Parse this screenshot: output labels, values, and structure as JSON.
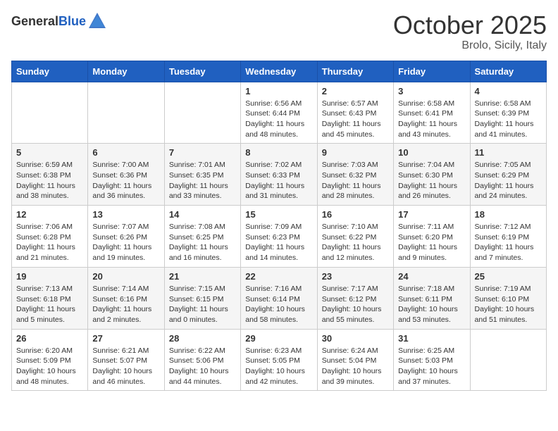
{
  "header": {
    "logo_general": "General",
    "logo_blue": "Blue",
    "month_title": "October 2025",
    "location": "Brolo, Sicily, Italy"
  },
  "days_of_week": [
    "Sunday",
    "Monday",
    "Tuesday",
    "Wednesday",
    "Thursday",
    "Friday",
    "Saturday"
  ],
  "weeks": [
    {
      "days": [
        {
          "number": "",
          "info": ""
        },
        {
          "number": "",
          "info": ""
        },
        {
          "number": "",
          "info": ""
        },
        {
          "number": "1",
          "info": "Sunrise: 6:56 AM\nSunset: 6:44 PM\nDaylight: 11 hours and 48 minutes."
        },
        {
          "number": "2",
          "info": "Sunrise: 6:57 AM\nSunset: 6:43 PM\nDaylight: 11 hours and 45 minutes."
        },
        {
          "number": "3",
          "info": "Sunrise: 6:58 AM\nSunset: 6:41 PM\nDaylight: 11 hours and 43 minutes."
        },
        {
          "number": "4",
          "info": "Sunrise: 6:58 AM\nSunset: 6:39 PM\nDaylight: 11 hours and 41 minutes."
        }
      ]
    },
    {
      "days": [
        {
          "number": "5",
          "info": "Sunrise: 6:59 AM\nSunset: 6:38 PM\nDaylight: 11 hours and 38 minutes."
        },
        {
          "number": "6",
          "info": "Sunrise: 7:00 AM\nSunset: 6:36 PM\nDaylight: 11 hours and 36 minutes."
        },
        {
          "number": "7",
          "info": "Sunrise: 7:01 AM\nSunset: 6:35 PM\nDaylight: 11 hours and 33 minutes."
        },
        {
          "number": "8",
          "info": "Sunrise: 7:02 AM\nSunset: 6:33 PM\nDaylight: 11 hours and 31 minutes."
        },
        {
          "number": "9",
          "info": "Sunrise: 7:03 AM\nSunset: 6:32 PM\nDaylight: 11 hours and 28 minutes."
        },
        {
          "number": "10",
          "info": "Sunrise: 7:04 AM\nSunset: 6:30 PM\nDaylight: 11 hours and 26 minutes."
        },
        {
          "number": "11",
          "info": "Sunrise: 7:05 AM\nSunset: 6:29 PM\nDaylight: 11 hours and 24 minutes."
        }
      ]
    },
    {
      "days": [
        {
          "number": "12",
          "info": "Sunrise: 7:06 AM\nSunset: 6:28 PM\nDaylight: 11 hours and 21 minutes."
        },
        {
          "number": "13",
          "info": "Sunrise: 7:07 AM\nSunset: 6:26 PM\nDaylight: 11 hours and 19 minutes."
        },
        {
          "number": "14",
          "info": "Sunrise: 7:08 AM\nSunset: 6:25 PM\nDaylight: 11 hours and 16 minutes."
        },
        {
          "number": "15",
          "info": "Sunrise: 7:09 AM\nSunset: 6:23 PM\nDaylight: 11 hours and 14 minutes."
        },
        {
          "number": "16",
          "info": "Sunrise: 7:10 AM\nSunset: 6:22 PM\nDaylight: 11 hours and 12 minutes."
        },
        {
          "number": "17",
          "info": "Sunrise: 7:11 AM\nSunset: 6:20 PM\nDaylight: 11 hours and 9 minutes."
        },
        {
          "number": "18",
          "info": "Sunrise: 7:12 AM\nSunset: 6:19 PM\nDaylight: 11 hours and 7 minutes."
        }
      ]
    },
    {
      "days": [
        {
          "number": "19",
          "info": "Sunrise: 7:13 AM\nSunset: 6:18 PM\nDaylight: 11 hours and 5 minutes."
        },
        {
          "number": "20",
          "info": "Sunrise: 7:14 AM\nSunset: 6:16 PM\nDaylight: 11 hours and 2 minutes."
        },
        {
          "number": "21",
          "info": "Sunrise: 7:15 AM\nSunset: 6:15 PM\nDaylight: 11 hours and 0 minutes."
        },
        {
          "number": "22",
          "info": "Sunrise: 7:16 AM\nSunset: 6:14 PM\nDaylight: 10 hours and 58 minutes."
        },
        {
          "number": "23",
          "info": "Sunrise: 7:17 AM\nSunset: 6:12 PM\nDaylight: 10 hours and 55 minutes."
        },
        {
          "number": "24",
          "info": "Sunrise: 7:18 AM\nSunset: 6:11 PM\nDaylight: 10 hours and 53 minutes."
        },
        {
          "number": "25",
          "info": "Sunrise: 7:19 AM\nSunset: 6:10 PM\nDaylight: 10 hours and 51 minutes."
        }
      ]
    },
    {
      "days": [
        {
          "number": "26",
          "info": "Sunrise: 6:20 AM\nSunset: 5:09 PM\nDaylight: 10 hours and 48 minutes."
        },
        {
          "number": "27",
          "info": "Sunrise: 6:21 AM\nSunset: 5:07 PM\nDaylight: 10 hours and 46 minutes."
        },
        {
          "number": "28",
          "info": "Sunrise: 6:22 AM\nSunset: 5:06 PM\nDaylight: 10 hours and 44 minutes."
        },
        {
          "number": "29",
          "info": "Sunrise: 6:23 AM\nSunset: 5:05 PM\nDaylight: 10 hours and 42 minutes."
        },
        {
          "number": "30",
          "info": "Sunrise: 6:24 AM\nSunset: 5:04 PM\nDaylight: 10 hours and 39 minutes."
        },
        {
          "number": "31",
          "info": "Sunrise: 6:25 AM\nSunset: 5:03 PM\nDaylight: 10 hours and 37 minutes."
        },
        {
          "number": "",
          "info": ""
        }
      ]
    }
  ]
}
